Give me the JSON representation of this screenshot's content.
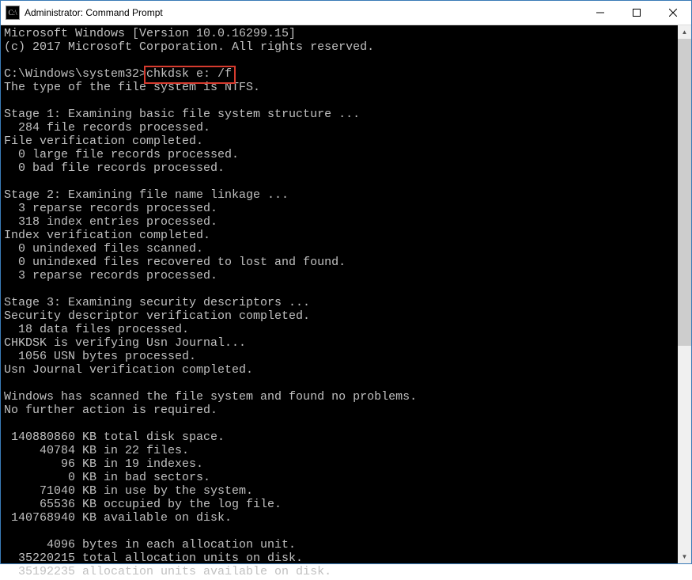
{
  "window": {
    "title": "Administrator: Command Prompt",
    "icon_label": "C:\\"
  },
  "terminal": {
    "prompt_prefix": "C:\\Windows\\system32>",
    "command": "chkdsk e: /f",
    "lines": {
      "l0": "Microsoft Windows [Version 10.0.16299.15]",
      "l1": "(c) 2017 Microsoft Corporation. All rights reserved.",
      "l2": "",
      "l3_after": "",
      "l4": "The type of the file system is NTFS.",
      "l5": "",
      "l6": "Stage 1: Examining basic file system structure ...",
      "l7": "  284 file records processed.",
      "l8": "File verification completed.",
      "l9": "  0 large file records processed.",
      "l10": "  0 bad file records processed.",
      "l11": "",
      "l12": "Stage 2: Examining file name linkage ...",
      "l13": "  3 reparse records processed.",
      "l14": "  318 index entries processed.",
      "l15": "Index verification completed.",
      "l16": "  0 unindexed files scanned.",
      "l17": "  0 unindexed files recovered to lost and found.",
      "l18": "  3 reparse records processed.",
      "l19": "",
      "l20": "Stage 3: Examining security descriptors ...",
      "l21": "Security descriptor verification completed.",
      "l22": "  18 data files processed.",
      "l23": "CHKDSK is verifying Usn Journal...",
      "l24": "  1056 USN bytes processed.",
      "l25": "Usn Journal verification completed.",
      "l26": "",
      "l27": "Windows has scanned the file system and found no problems.",
      "l28": "No further action is required.",
      "l29": "",
      "l30": " 140880860 KB total disk space.",
      "l31": "     40784 KB in 22 files.",
      "l32": "        96 KB in 19 indexes.",
      "l33": "         0 KB in bad sectors.",
      "l34": "     71040 KB in use by the system.",
      "l35": "     65536 KB occupied by the log file.",
      "l36": " 140768940 KB available on disk.",
      "l37": "",
      "l38": "      4096 bytes in each allocation unit.",
      "l39": "  35220215 total allocation units on disk.",
      "l40": "  35192235 allocation units available on disk."
    }
  },
  "highlight": {
    "target": "command"
  }
}
